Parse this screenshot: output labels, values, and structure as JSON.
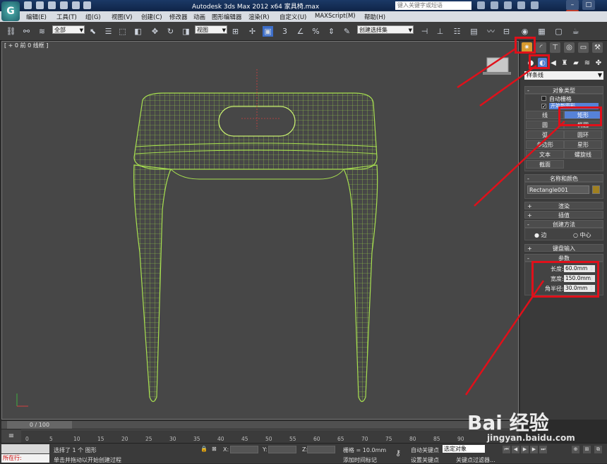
{
  "title": "Autodesk 3ds Max  2012 x64      家具椅.max",
  "search_placeholder": "键入关键字或短语",
  "menu": [
    "编辑(E)",
    "工具(T)",
    "组(G)",
    "视图(V)",
    "创建(C)",
    "修改器",
    "动画",
    "图形编辑器",
    "渲染(R)",
    "自定义(U)",
    "MAXScript(M)",
    "帮助(H)"
  ],
  "toolbar": {
    "selection_filter": "全部",
    "reference_coord": "视图",
    "named_selection": "创建选择集"
  },
  "viewport": {
    "label": "[ + 0 前 0 线框 ]"
  },
  "command_panel": {
    "category_dropdown": "样条线",
    "object_type_title": "对象类型",
    "auto_grid": "自动栅格",
    "start_new_shape": "开始新图形",
    "buttons": [
      {
        "label": "线"
      },
      {
        "label": "矩形"
      },
      {
        "label": "圆"
      },
      {
        "label": "椭圆"
      },
      {
        "label": "弧"
      },
      {
        "label": "圆环"
      },
      {
        "label": "多边形"
      },
      {
        "label": "星形"
      },
      {
        "label": "文本"
      },
      {
        "label": "螺旋线"
      },
      {
        "label": "截面"
      }
    ],
    "name_color_title": "名称和颜色",
    "object_name": "Rectangle001",
    "object_color": "#a08020",
    "rollouts": {
      "render": "渲染",
      "interp": "插值",
      "creation_method": "创建方法",
      "keyboard": "键盘输入",
      "params": "参数"
    },
    "creation": {
      "edge": "边",
      "center": "中心"
    },
    "params": [
      {
        "label": "长度:",
        "value": "60.0mm"
      },
      {
        "label": "宽度:",
        "value": "150.0mm"
      },
      {
        "label": "角半径:",
        "value": "30.0mm"
      }
    ]
  },
  "timeline": {
    "frame": "0 / 100",
    "ticks": [
      "0",
      "5",
      "10",
      "15",
      "20",
      "25",
      "30",
      "35",
      "40",
      "45",
      "50",
      "55",
      "60",
      "65",
      "70",
      "75",
      "80",
      "85",
      "90"
    ]
  },
  "status": {
    "maxscript_label": "所在行:",
    "selected": "选择了 1 个 图形",
    "prompt": "单击并拖动以开始创建过程",
    "x": "X:",
    "y": "Y:",
    "z": "Z:",
    "grid": "栅格 = 10.0mm",
    "add_time_tag": "添加时间标记",
    "auto_key": "自动关键点",
    "set_key": "设置关键点",
    "key_filter": "关键点过滤器...",
    "selected_object": "选定对象"
  },
  "watermark": {
    "logo": "Bai 经验",
    "url": "jingyan.baidu.com"
  }
}
